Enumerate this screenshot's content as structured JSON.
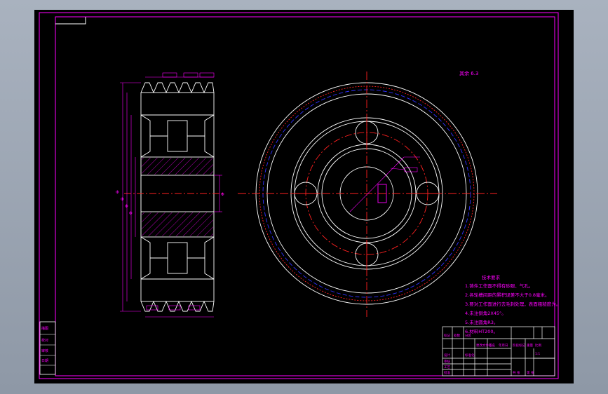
{
  "colors": {
    "frame": "#ff00ff",
    "geometry": "#ffffff",
    "center_line": "#ff2020",
    "pitch_line": "#3030ff",
    "notes_text": "#ff00ff",
    "background": "#000000",
    "viewport": "#9aa4b1"
  },
  "drawing": {
    "roughness_note": "其余 6.3",
    "diameter_labels": [
      "Φ",
      "Φ",
      "Φ",
      "Φ",
      "Φ"
    ],
    "tech_requirements": {
      "title": "技术要求",
      "items": [
        "1.铸件工作面不得有砂眼、气孔。",
        "2.各轮槽间距的累积误差不大于0.8毫米。",
        "3.要对工作面进行去毛刺处理，表面粗糙度为。",
        "4.未注倒角2X45°。",
        "5.未注圆角R3。",
        "6.材料HT200。"
      ]
    },
    "left_stamp_rows": [
      "描图",
      "校对",
      "审核",
      "日期"
    ],
    "title_block": {
      "cells": [
        "标记",
        "处数",
        "分区",
        "更改文件号",
        "签名",
        "年月日",
        "设计",
        "标准化",
        "审核",
        "工艺",
        "批准",
        "阶段标记",
        "重量",
        "比例",
        "共 张",
        "第 张",
        "1:1"
      ]
    }
  }
}
